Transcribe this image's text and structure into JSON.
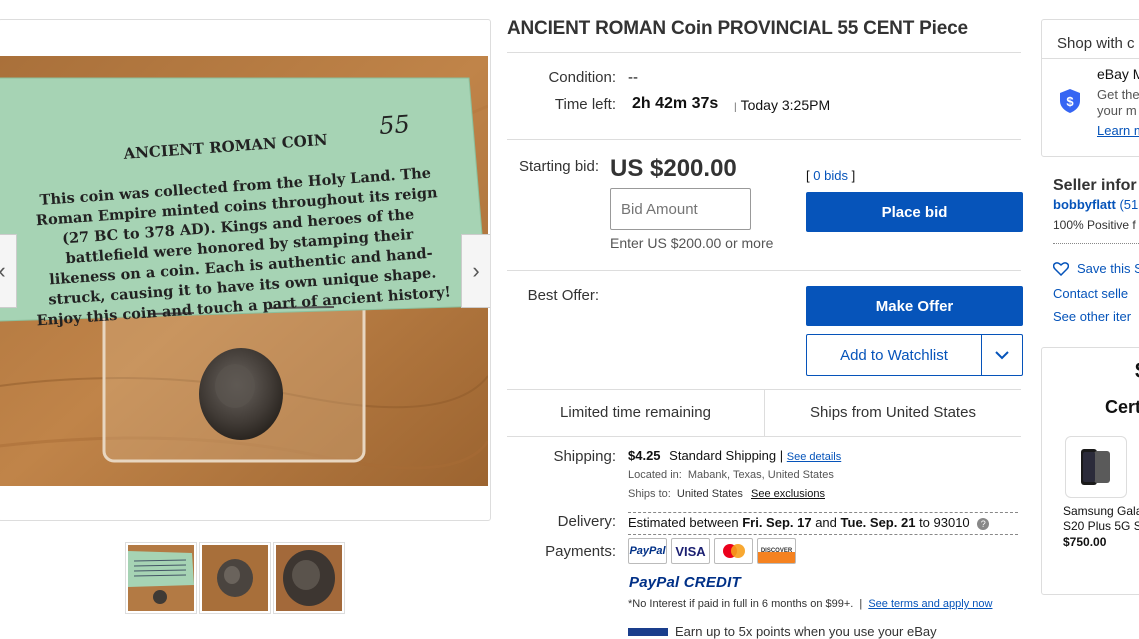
{
  "listing": {
    "title": "ANCIENT ROMAN Coin PROVINCIAL 55 CENT Piece",
    "condition_label": "Condition:",
    "condition_value": "--",
    "time_left_label": "Time left:",
    "time_left_value": "2h 42m 37s",
    "time_end": "Today 3:25PM"
  },
  "photo_card": {
    "heading": "ANCIENT ROMAN COIN",
    "number": "55",
    "lines": [
      "This coin was collected from the Holy Land.  The",
      "Roman Empire minted coins throughout its reign",
      "(27 BC to 378 AD).  Kings and heroes of the",
      "battlefield were honored by stamping their",
      "likeness on a coin.  Each is authentic and hand-",
      "struck, causing it to have its own unique shape.",
      "Enjoy this coin and touch a part of ancient history!"
    ]
  },
  "gallery": {
    "prev_arrow": "‹",
    "next_arrow": "›"
  },
  "bid": {
    "starting_label": "Starting bid:",
    "price": "US $200.00",
    "bid_open": "[",
    "bids_link": "0 bids",
    "bid_close": "]",
    "input_placeholder": "Bid Amount",
    "hint": "Enter US $200.00 or more",
    "place_bid": "Place bid"
  },
  "offer": {
    "label": "Best Offer:",
    "make_offer": "Make Offer",
    "watchlist": "Add to Watchlist"
  },
  "badges": {
    "left": "Limited time remaining",
    "right": "Ships from United States"
  },
  "shipping": {
    "label": "Shipping:",
    "cost": "$4.25",
    "method": "Standard Shipping",
    "sep": "|",
    "details_link": "See details",
    "located_label": "Located in:",
    "located_value": "Mabank, Texas, United States",
    "ships_to_label": "Ships to:",
    "ships_to_value": "United States",
    "exclusions_link": "See exclusions"
  },
  "delivery": {
    "label": "Delivery:",
    "prefix": "Estimated between",
    "date1": "Fri. Sep. 17",
    "and": "and",
    "date2": "Tue. Sep. 21",
    "suffix": "to 93010",
    "help": "?"
  },
  "payments": {
    "label": "Payments:",
    "cards": [
      "PayPal",
      "VISA",
      "",
      "DISCOVER"
    ],
    "credit_logo": "PayPal CREDIT",
    "credit_note": "*No Interest if paid in full in 6 months on $99+.",
    "credit_sep": "|",
    "credit_link": "See terms and apply now",
    "ebay_points": "Earn up to 5x points when you use your eBay"
  },
  "shop_panel": {
    "title": "Shop with c",
    "mastercard_title": "eBay M",
    "line1": "Get the",
    "line2": "your m",
    "learn": "Learn m"
  },
  "seller": {
    "title": "Seller infor",
    "name": "bobbyflatt",
    "score": "(51",
    "feedback": "100% Positive f",
    "save": "Save this S",
    "contact": "Contact selle",
    "other": "See other iter"
  },
  "promo": {
    "symbol": "$",
    "heading": "Cert",
    "product_name_1": "Samsung Gala",
    "product_name_2": "S20 Plus 5G S",
    "price": "$750.00"
  },
  "colors": {
    "accent": "#0654ba",
    "paypal_blue": "#003087",
    "paypal_light": "#009cde"
  }
}
